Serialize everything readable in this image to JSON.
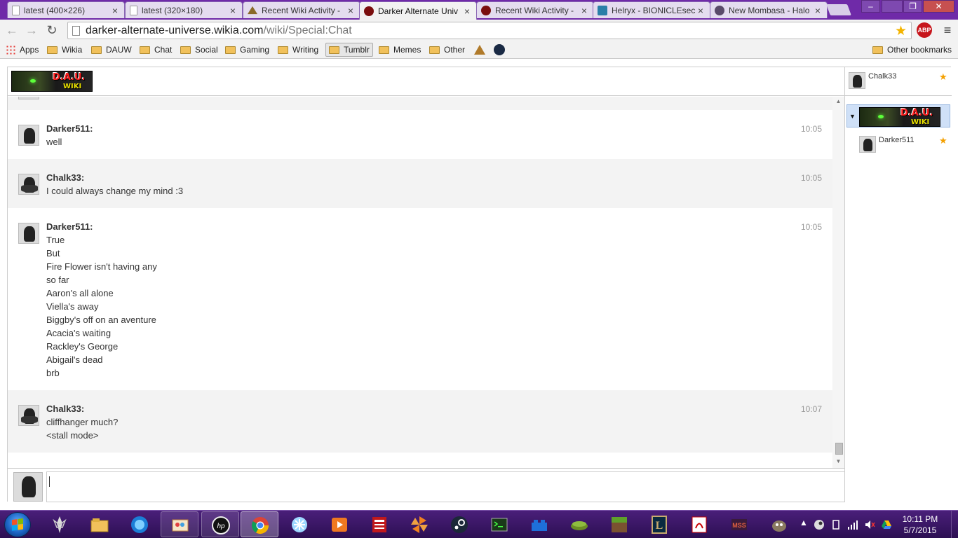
{
  "browser": {
    "tabs": [
      {
        "title": "latest (400×226)",
        "icon": "page-icon"
      },
      {
        "title": "latest (320×180)",
        "icon": "page-icon"
      },
      {
        "title": "Recent Wiki Activity -",
        "icon": "bionicle-icon"
      },
      {
        "title": "Darker Alternate Univ",
        "icon": "dau-wiki-icon",
        "active": true
      },
      {
        "title": "Recent Wiki Activity -",
        "icon": "dau-wiki-icon"
      },
      {
        "title": "Helryx - BIONICLEsec",
        "icon": "helryx-icon"
      },
      {
        "title": "New Mombasa - Halo",
        "icon": "halo-icon"
      }
    ],
    "tab_close_glyph": "×",
    "window_controls": {
      "minimize": "–",
      "maximize": "❐",
      "close": "✕"
    },
    "url": {
      "host": "darker-alternate-universe.wikia.com",
      "path": "/wiki/Special:Chat"
    },
    "nav": {
      "back": "←",
      "forward": "→",
      "reload": "↻"
    },
    "extension_label": "ABP",
    "menu_glyph": "≡",
    "bookmark_star": "★"
  },
  "bookmarks": {
    "items": [
      {
        "label": "Apps",
        "icon": "apps-grid-icon"
      },
      {
        "label": "Wikia",
        "icon": "folder-icon"
      },
      {
        "label": "DAUW",
        "icon": "folder-icon"
      },
      {
        "label": "Chat",
        "icon": "folder-icon"
      },
      {
        "label": "Social",
        "icon": "folder-icon"
      },
      {
        "label": "Gaming",
        "icon": "folder-icon"
      },
      {
        "label": "Writing",
        "icon": "folder-icon"
      },
      {
        "label": "Tumblr",
        "icon": "folder-icon",
        "pressed": true
      },
      {
        "label": "Memes",
        "icon": "folder-icon"
      },
      {
        "label": "Other",
        "icon": "folder-icon"
      }
    ],
    "other_bookmarks": "Other bookmarks"
  },
  "chat": {
    "wiki_logo_text": "D.A.U.",
    "wiki_logo_sub": "WIKI",
    "messages": [
      {
        "user": "Darker511:",
        "time": "10:05",
        "lines": [
          "well"
        ],
        "alt": false
      },
      {
        "user": "Chalk33:",
        "time": "10:05",
        "lines": [
          "I could always change my mind :3"
        ],
        "alt": true
      },
      {
        "user": "Darker511:",
        "time": "10:05",
        "lines": [
          "True",
          "But",
          "Fire Flower isn't having any",
          "so far",
          "Aaron's all alone",
          "Viella's away",
          "Biggby's off on an aventure",
          "Acacia's waiting",
          "Rackley's George",
          "Abigail's dead",
          "brb"
        ],
        "alt": false
      },
      {
        "user": "Chalk33:",
        "time": "10:07",
        "lines": [
          "cliffhanger much?",
          "<stall mode>"
        ],
        "alt": true
      }
    ],
    "input_value": ""
  },
  "sidebar": {
    "me": {
      "name": "Chalk33"
    },
    "room_logo_text": "D.A.U.",
    "room_logo_sub": "WIKI",
    "room_toggle": "▼",
    "users": [
      {
        "name": "Darker511"
      }
    ],
    "star_glyph": "★"
  },
  "taskbar": {
    "apps": [
      "skyrim-icon",
      "file-explorer-icon",
      "app-orb-icon",
      "paint-icon",
      "hp-icon",
      "chrome-icon",
      "snowflake-icon",
      "media-player-icon",
      "news-icon",
      "pinwheel-icon",
      "steam-icon",
      "terminal-icon",
      "lego-brick-icon",
      "grass-block-icon",
      "minecraft-icon",
      "league-icon",
      "pdf-icon",
      "game-icon",
      "gimp-icon"
    ],
    "time": "10:11 PM",
    "date": "5/7/2015"
  }
}
